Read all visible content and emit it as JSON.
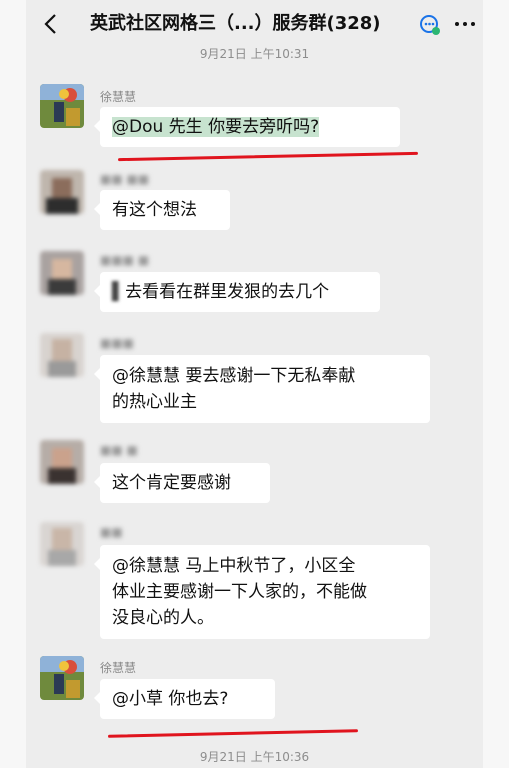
{
  "header": {
    "back_label": "<",
    "title": "英武社区网格三（...）服务群(328)",
    "more_label": "···"
  },
  "timestamps": {
    "top": "9月21日 上午10:31",
    "bottom": "9月21日 上午10:36"
  },
  "messages": [
    {
      "sender": "徐慧慧",
      "text": "@Dou    先生    你要去旁听吗?"
    },
    {
      "sender": "",
      "text": "有这个想法"
    },
    {
      "sender": "",
      "text": "去看看在群里发狠的去几个"
    },
    {
      "sender": "",
      "text_line1": "@徐慧慧    要去感谢一下无私奉献",
      "text_line2": "的热心业主"
    },
    {
      "sender": "",
      "text": "这个肯定要感谢"
    },
    {
      "sender": "",
      "text_line1": "@徐慧慧    马上中秋节了，小区全",
      "text_line2": "体业主要感谢一下人家的，不能做",
      "text_line3": "没良心的人。"
    },
    {
      "sender": "徐慧慧",
      "text": "@小草    你也去?"
    }
  ],
  "colors": {
    "background": "#ededed",
    "bubble": "#ffffff",
    "highlight": "#c7e3cf",
    "annotation_red": "#e0141e"
  }
}
